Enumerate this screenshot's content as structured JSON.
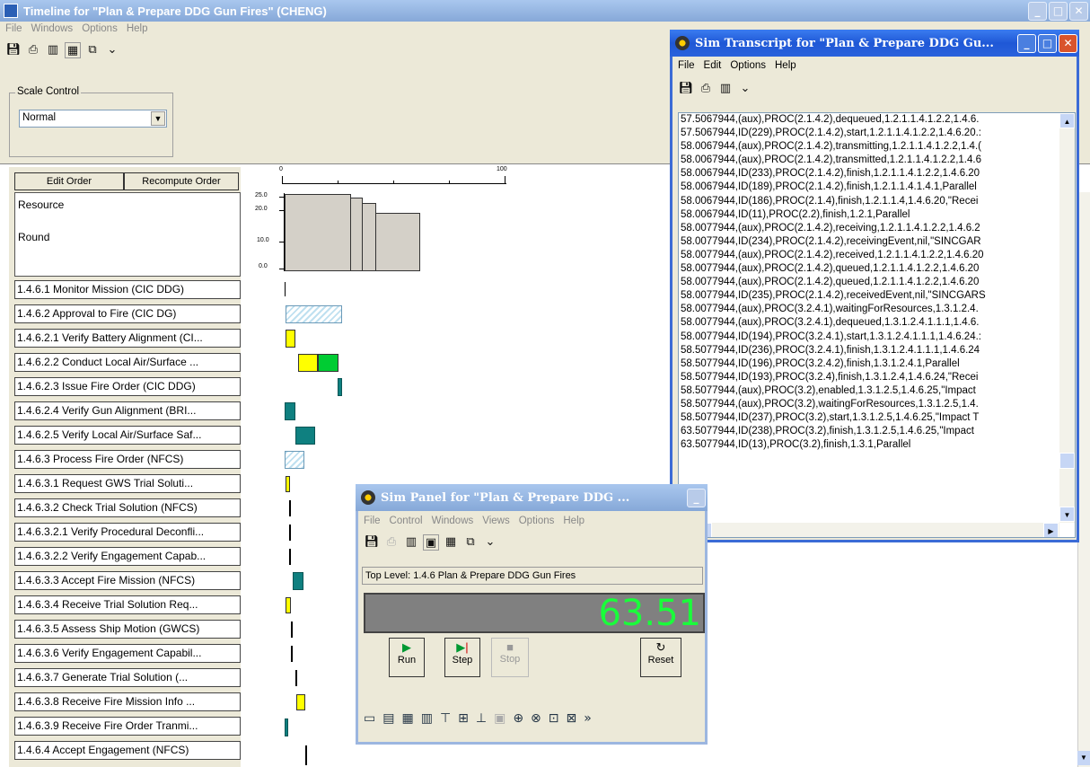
{
  "timeline": {
    "title": "Timeline for \"Plan & Prepare DDG Gun Fires\" (CHENG)",
    "menu": [
      "File",
      "Windows",
      "Options",
      "Help"
    ],
    "scale_label": "Scale Control",
    "scale_value": "Normal",
    "edit_order": "Edit Order",
    "recompute_order": "Recompute Order",
    "resource_label": "Resource",
    "round_label": "Round",
    "ticks": [
      "0",
      "100"
    ],
    "resource_axis": [
      "25.0",
      "20.0",
      "10.0",
      "0.0"
    ],
    "tasks": [
      "1.4.6.1 Monitor Mission (CIC DDG)",
      "1.4.6.2 Approval to Fire (CIC DG)",
      "1.4.6.2.1 Verify Battery Alignment (CI...",
      "1.4.6.2.2 Conduct Local Air/Surface ...",
      "1.4.6.2.3 Issue Fire Order (CIC DDG)",
      "1.4.6.2.4 Verify Gun Alignment (BRI...",
      "1.4.6.2.5 Verify Local Air/Surface Saf...",
      "1.4.6.3 Process Fire Order (NFCS)",
      "1.4.6.3.1 Request GWS  Trial  Soluti...",
      "1.4.6.3.2 Check Trial Solution (NFCS)",
      "1.4.6.3.2.1 Verify Procedural Deconfli...",
      "1.4.6.3.2.2 Verify Engagement Capab...",
      "1.4.6.3.3 Accept Fire Mission (NFCS)",
      "1.4.6.3.4 Receive Trial Solution Req...",
      "1.4.6.3.5 Assess Ship Motion (GWCS)",
      "1.4.6.3.6 Verify Engagement Capabil...",
      "1.4.6.3.7 Generate Trial Solution (...",
      "1.4.6.3.8 Receive Fire Mission Info ...",
      "1.4.6.3.9 Receive Fire Order Tranmi...",
      "1.4.6.4 Accept Engagement (NFCS)"
    ]
  },
  "transcript": {
    "title": "Sim Transcript for \"Plan & Prepare DDG Gu...",
    "menu": [
      "File",
      "Edit",
      "Options",
      "Help"
    ],
    "lines": [
      "57.5067944,(aux),PROC(2.1.4.2),dequeued,1.2.1.1.4.1.2.2,1.4.6.",
      "57.5067944,ID(229),PROC(2.1.4.2),start,1.2.1.1.4.1.2.2,1.4.6.20.:",
      "58.0067944,(aux),PROC(2.1.4.2),transmitting,1.2.1.1.4.1.2.2,1.4.(",
      "58.0067944,(aux),PROC(2.1.4.2),transmitted,1.2.1.1.4.1.2.2,1.4.6",
      "58.0067944,ID(233),PROC(2.1.4.2),finish,1.2.1.1.4.1.2.2,1.4.6.20",
      "58.0067944,ID(189),PROC(2.1.4.2),finish,1.2.1.1.4.1.4.1,Parallel",
      "58.0067944,ID(186),PROC(2.1.4),finish,1.2.1.1.4,1.4.6.20,\"Recei",
      "58.0067944,ID(11),PROC(2.2),finish,1.2.1,Parallel",
      "58.0077944,(aux),PROC(2.1.4.2),receiving,1.2.1.1.4.1.2.2,1.4.6.2",
      "58.0077944,ID(234),PROC(2.1.4.2),receivingEvent,nil,\"SINCGAR",
      "58.0077944,(aux),PROC(2.1.4.2),received,1.2.1.1.4.1.2.2,1.4.6.20",
      "58.0077944,(aux),PROC(2.1.4.2),queued,1.2.1.1.4.1.2.2,1.4.6.20",
      "58.0077944,(aux),PROC(2.1.4.2),queued,1.2.1.1.4.1.2.2,1.4.6.20",
      "58.0077944,ID(235),PROC(2.1.4.2),receivedEvent,nil,\"SINCGARS",
      "58.0077944,(aux),PROC(3.2.4.1),waitingForResources,1.3.1.2.4.",
      "58.0077944,(aux),PROC(3.2.4.1),dequeued,1.3.1.2.4.1.1.1,1.4.6.",
      "58.0077944,ID(194),PROC(3.2.4.1),start,1.3.1.2.4.1.1.1,1.4.6.24.:",
      "58.5077944,ID(236),PROC(3.2.4.1),finish,1.3.1.2.4.1.1.1,1.4.6.24",
      "58.5077944,ID(196),PROC(3.2.4.2),finish,1.3.1.2.4.1,Parallel",
      "58.5077944,ID(193),PROC(3.2.4),finish,1.3.1.2.4,1.4.6.24,\"Recei",
      "58.5077944,(aux),PROC(3.2),enabled,1.3.1.2.5,1.4.6.25,\"Impact",
      "58.5077944,(aux),PROC(3.2),waitingForResources,1.3.1.2.5,1.4.",
      "58.5077944,ID(237),PROC(3.2),start,1.3.1.2.5,1.4.6.25,\"Impact T",
      "63.5077944,ID(238),PROC(3.2),finish,1.3.1.2.5,1.4.6.25,\"Impact",
      "63.5077944,ID(13),PROC(3.2),finish,1.3.1,Parallel"
    ]
  },
  "simpanel": {
    "title": "Sim Panel for \"Plan & Prepare DDG ...",
    "menu": [
      "File",
      "Control",
      "Windows",
      "Views",
      "Options",
      "Help"
    ],
    "top_level_label": "Top Level:",
    "top_level_value": "1.4.6 Plan & Prepare DDG Gun Fires",
    "clock": "63.51",
    "run": "Run",
    "step": "Step",
    "stop": "Stop",
    "reset": "Reset"
  }
}
